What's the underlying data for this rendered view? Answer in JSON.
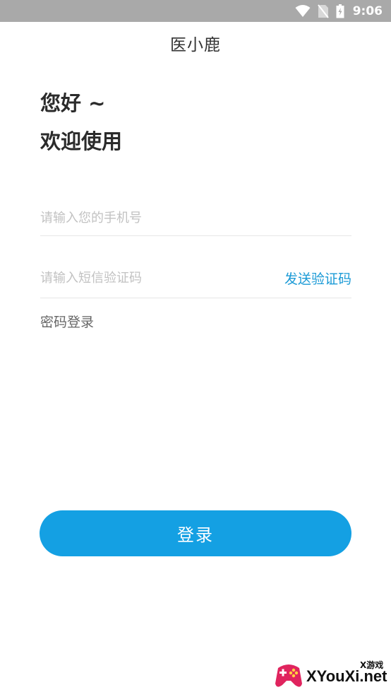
{
  "status_bar": {
    "time": "9:06",
    "icons": [
      "wifi-icon",
      "no-sim-icon",
      "battery-icon"
    ],
    "background": "#a9a9a9"
  },
  "header": {
    "title": "医小鹿"
  },
  "greeting": {
    "line1": "您好 ~",
    "line2": "欢迎使用"
  },
  "form": {
    "phone_placeholder": "请输入您的手机号",
    "phone_value": "",
    "code_placeholder": "请输入短信验证码",
    "code_value": "",
    "send_code_label": "发送验证码",
    "password_login_label": "密码登录"
  },
  "login_button": {
    "label": "登录"
  },
  "watermark": {
    "text": "XYouXi.net",
    "sub": "X游戏",
    "logo": "gamepad-logo"
  },
  "colors": {
    "accent": "#14a0e3",
    "link": "#1a9ad6",
    "placeholder": "#c2c2c2"
  }
}
